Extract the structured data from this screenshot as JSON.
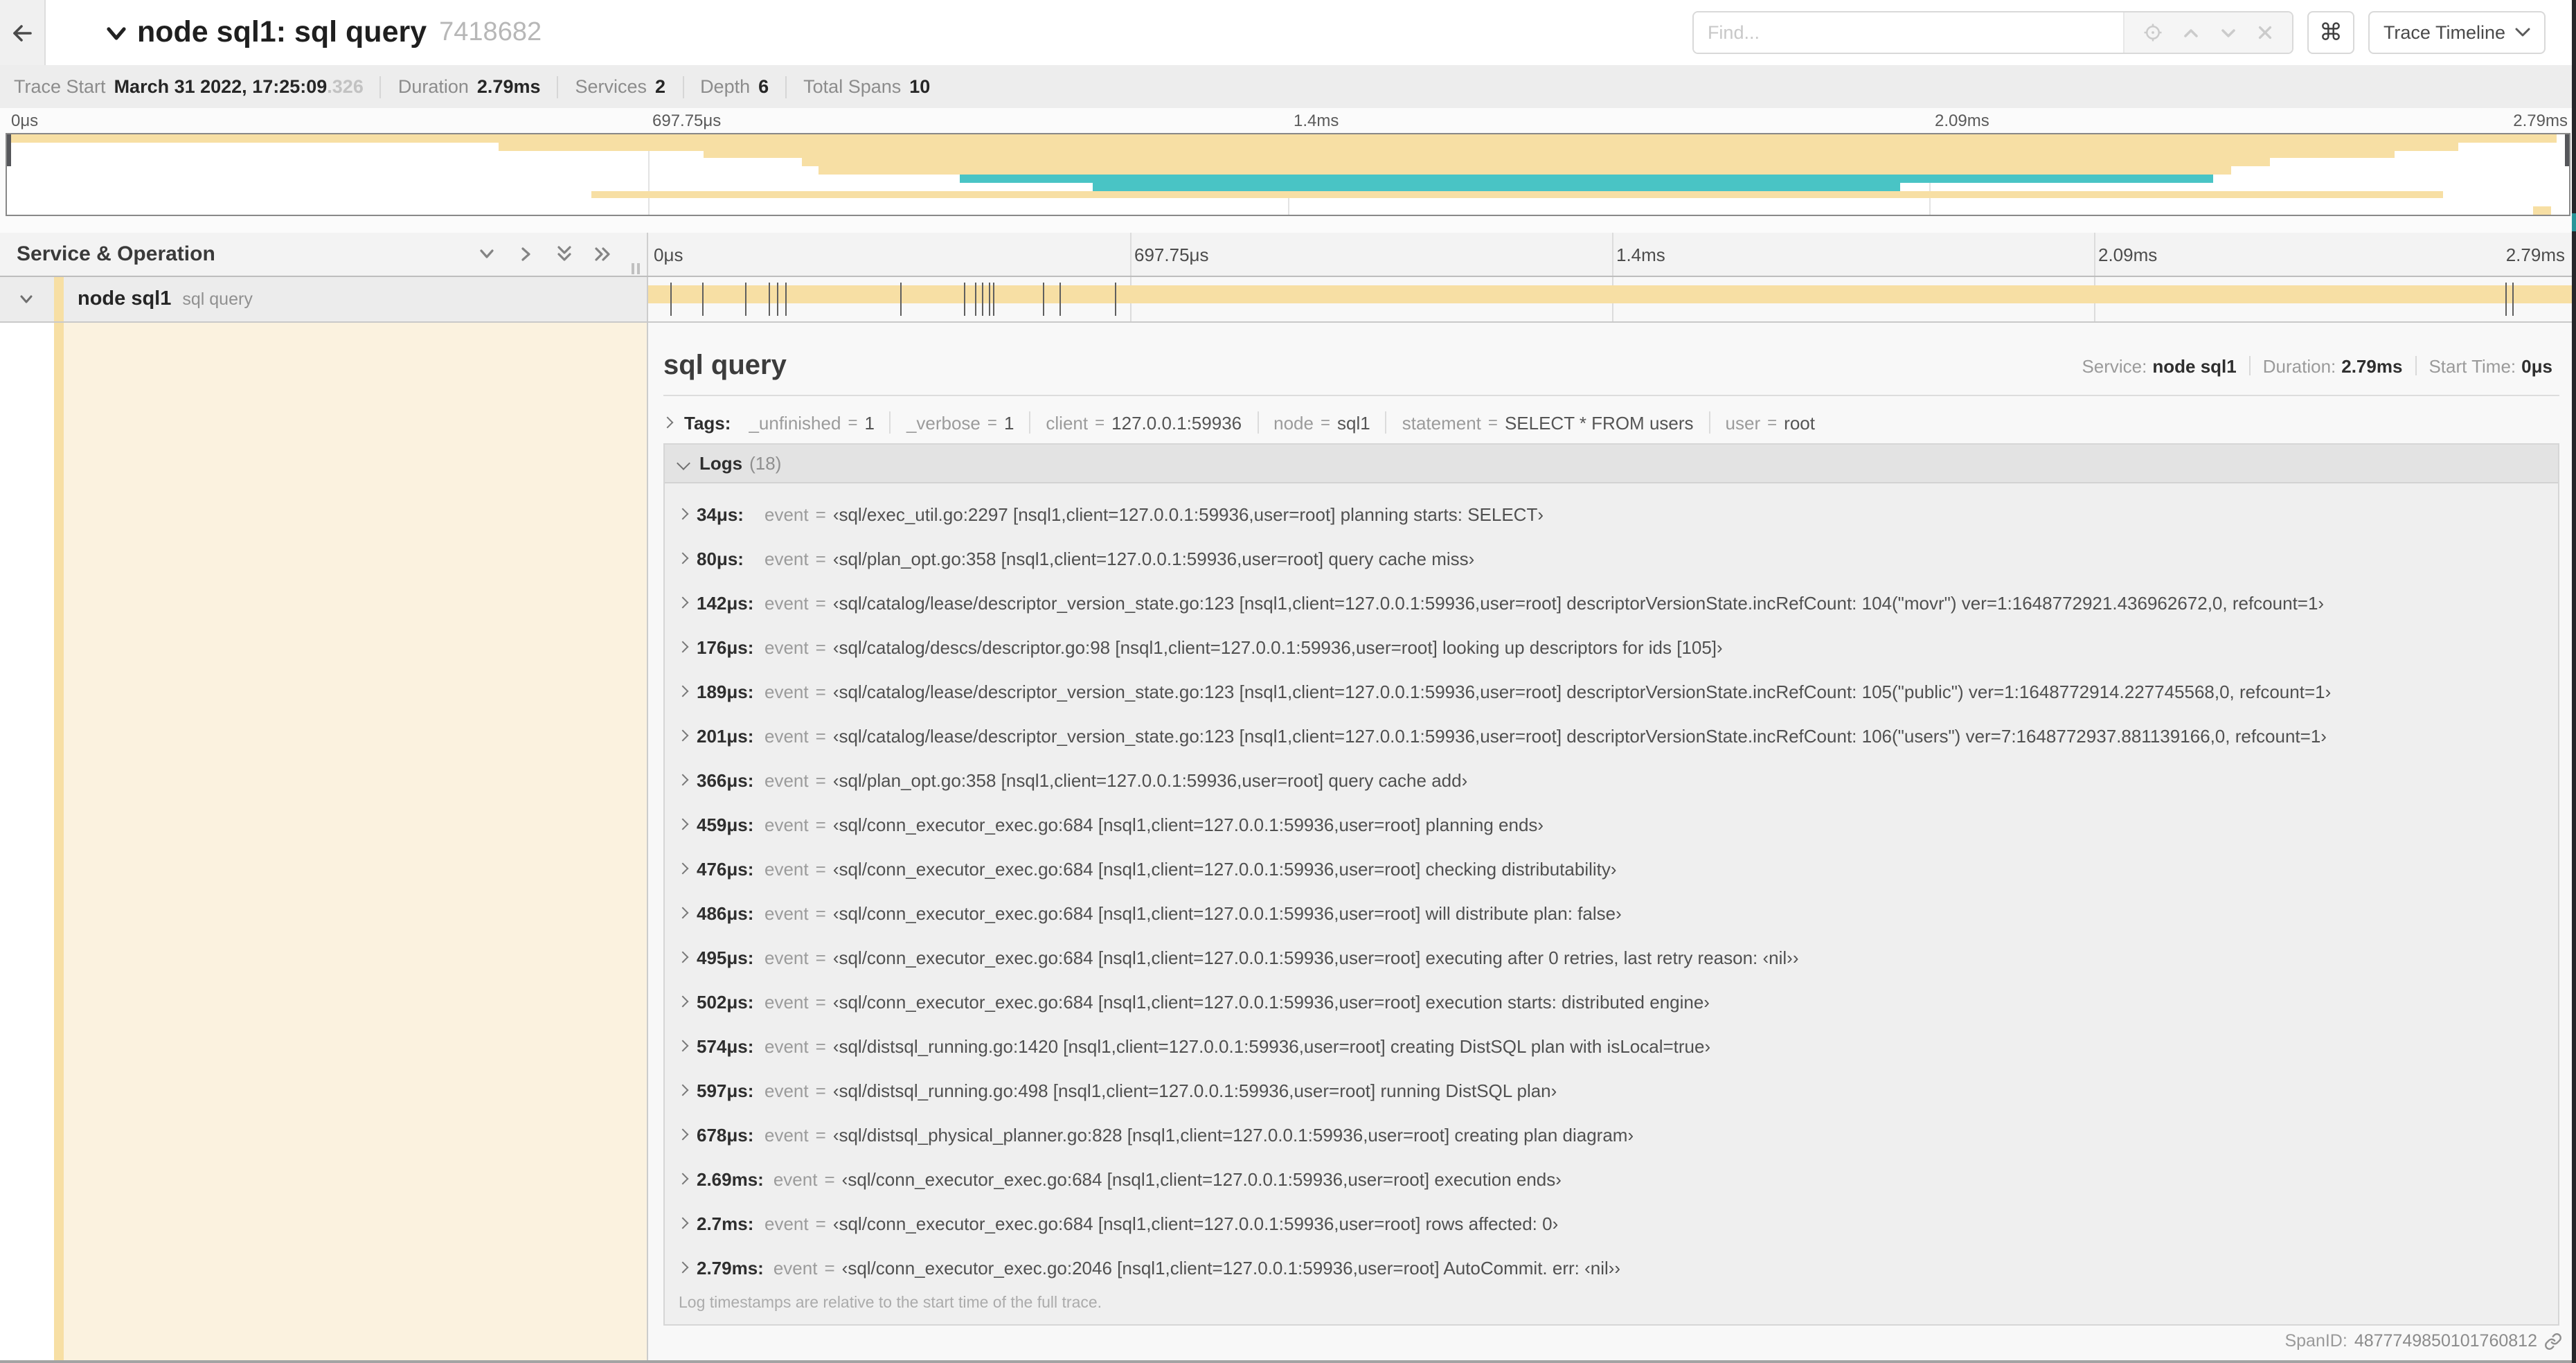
{
  "colors": {
    "tan": "#F7DFA4",
    "teal": "#49C4C5",
    "expanded_bg": "#FBF2DF"
  },
  "header": {
    "title": "node sql1: sql query",
    "trace_id": "7418682",
    "find_placeholder": "Find...",
    "command_glyph": "⌘",
    "view_selector": "Trace Timeline"
  },
  "info": {
    "items": [
      {
        "label": "Trace Start",
        "value": "March 31 2022, 17:25:09",
        "suffix": ".326"
      },
      {
        "label": "Duration",
        "value": "2.79ms"
      },
      {
        "label": "Services",
        "value": "2"
      },
      {
        "label": "Depth",
        "value": "6"
      },
      {
        "label": "Total Spans",
        "value": "10"
      }
    ]
  },
  "timeline": {
    "total_us": 2790,
    "ruler": [
      {
        "label": "0μs",
        "pos": 0
      },
      {
        "label": "697.75μs",
        "pos": 25
      },
      {
        "label": "1.4ms",
        "pos": 50
      },
      {
        "label": "2.09ms",
        "pos": 75
      },
      {
        "label": "2.79ms",
        "pos": 100
      }
    ]
  },
  "minimap": {
    "bars": [
      {
        "row": 0,
        "start": 0,
        "end": 99.5,
        "color": "tan"
      },
      {
        "row": 1,
        "start": 19.2,
        "end": 95.7,
        "color": "tan"
      },
      {
        "row": 2,
        "start": 27.2,
        "end": 93.2,
        "color": "tan"
      },
      {
        "row": 3,
        "start": 31.0,
        "end": 88.3,
        "color": "tan"
      },
      {
        "row": 4,
        "start": 31.7,
        "end": 86.8,
        "color": "tan"
      },
      {
        "row": 5,
        "start": 37.2,
        "end": 86.1,
        "color": "teal"
      },
      {
        "row": 6,
        "start": 42.4,
        "end": 73.9,
        "color": "teal"
      },
      {
        "row": 7,
        "start": 22.8,
        "end": 95.1,
        "color": "tan"
      },
      {
        "row": 9,
        "start": 98.6,
        "end": 99.3,
        "color": "tan"
      }
    ]
  },
  "left_panel": {
    "header": "Service & Operation",
    "service": "node sql1",
    "operation": "sql query"
  },
  "detail": {
    "title": "sql query",
    "overview": [
      {
        "label": "Service:",
        "value": "node sql1"
      },
      {
        "label": "Duration:",
        "value": "2.79ms"
      },
      {
        "label": "Start Time:",
        "value": "0μs"
      }
    ],
    "tags_label": "Tags:",
    "tags": [
      {
        "key": "_unfinished",
        "value": "1"
      },
      {
        "key": "_verbose",
        "value": "1"
      },
      {
        "key": "client",
        "value": "127.0.0.1:59936"
      },
      {
        "key": "node",
        "value": "sql1"
      },
      {
        "key": "statement",
        "value": "SELECT * FROM users"
      },
      {
        "key": "user",
        "value": "root"
      }
    ],
    "logs_label": "Logs",
    "logs_count": "(18)",
    "event_key": "event",
    "logs": [
      {
        "t": "34μs:",
        "us": 34,
        "msg": "‹sql/exec_util.go:2297 [nsql1,client=127.0.0.1:59936,user=root] planning starts: SELECT›"
      },
      {
        "t": "80μs:",
        "us": 80,
        "msg": "‹sql/plan_opt.go:358 [nsql1,client=127.0.0.1:59936,user=root] query cache miss›"
      },
      {
        "t": "142μs:",
        "us": 142,
        "msg": "‹sql/catalog/lease/descriptor_version_state.go:123 [nsql1,client=127.0.0.1:59936,user=root] descriptorVersionState.incRefCount: 104(\"movr\") ver=1:1648772921.436962672,0, refcount=1›"
      },
      {
        "t": "176μs:",
        "us": 176,
        "msg": "‹sql/catalog/descs/descriptor.go:98 [nsql1,client=127.0.0.1:59936,user=root] looking up descriptors for ids [105]›"
      },
      {
        "t": "189μs:",
        "us": 189,
        "msg": "‹sql/catalog/lease/descriptor_version_state.go:123 [nsql1,client=127.0.0.1:59936,user=root] descriptorVersionState.incRefCount: 105(\"public\") ver=1:1648772914.227745568,0, refcount=1›"
      },
      {
        "t": "201μs:",
        "us": 201,
        "msg": "‹sql/catalog/lease/descriptor_version_state.go:123 [nsql1,client=127.0.0.1:59936,user=root] descriptorVersionState.incRefCount: 106(\"users\") ver=7:1648772937.881139166,0, refcount=1›"
      },
      {
        "t": "366μs:",
        "us": 366,
        "msg": "‹sql/plan_opt.go:358 [nsql1,client=127.0.0.1:59936,user=root] query cache add›"
      },
      {
        "t": "459μs:",
        "us": 459,
        "msg": "‹sql/conn_executor_exec.go:684 [nsql1,client=127.0.0.1:59936,user=root] planning ends›"
      },
      {
        "t": "476μs:",
        "us": 476,
        "msg": "‹sql/conn_executor_exec.go:684 [nsql1,client=127.0.0.1:59936,user=root] checking distributability›"
      },
      {
        "t": "486μs:",
        "us": 486,
        "msg": "‹sql/conn_executor_exec.go:684 [nsql1,client=127.0.0.1:59936,user=root] will distribute plan: false›"
      },
      {
        "t": "495μs:",
        "us": 495,
        "msg": "‹sql/conn_executor_exec.go:684 [nsql1,client=127.0.0.1:59936,user=root] executing after 0 retries, last retry reason: ‹nil››"
      },
      {
        "t": "502μs:",
        "us": 502,
        "msg": "‹sql/conn_executor_exec.go:684 [nsql1,client=127.0.0.1:59936,user=root] execution starts: distributed engine›"
      },
      {
        "t": "574μs:",
        "us": 574,
        "msg": "‹sql/distsql_running.go:1420 [nsql1,client=127.0.0.1:59936,user=root] creating DistSQL plan with isLocal=true›"
      },
      {
        "t": "597μs:",
        "us": 597,
        "msg": "‹sql/distsql_running.go:498 [nsql1,client=127.0.0.1:59936,user=root] running DistSQL plan›"
      },
      {
        "t": "678μs:",
        "us": 678,
        "msg": "‹sql/distsql_physical_planner.go:828 [nsql1,client=127.0.0.1:59936,user=root] creating plan diagram›"
      },
      {
        "t": "2.69ms:",
        "us": 2690,
        "msg": "‹sql/conn_executor_exec.go:684 [nsql1,client=127.0.0.1:59936,user=root] execution ends›"
      },
      {
        "t": "2.7ms:",
        "us": 2700,
        "msg": "‹sql/conn_executor_exec.go:684 [nsql1,client=127.0.0.1:59936,user=root] rows affected: 0›"
      },
      {
        "t": "2.79ms:",
        "us": 2790,
        "msg": "‹sql/conn_executor_exec.go:2046 [nsql1,client=127.0.0.1:59936,user=root] AutoCommit. err: ‹nil››"
      }
    ],
    "footer_note": "Log timestamps are relative to the start time of the full trace.",
    "spanid_label": "SpanID:",
    "spanid": "4877749850101760812"
  }
}
